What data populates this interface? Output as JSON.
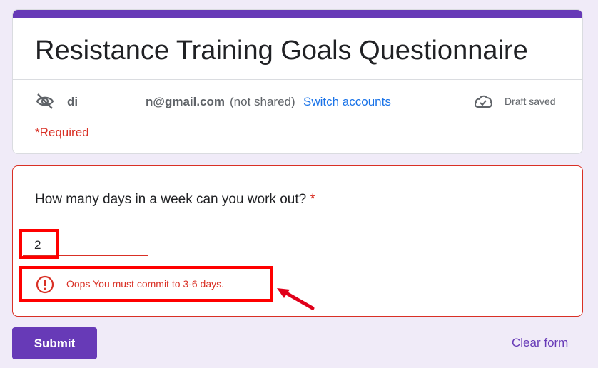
{
  "form": {
    "title": "Resistance Training Goals Questionnaire",
    "account_name": "di",
    "account_email": "n@gmail.com",
    "not_shared": "(not shared)",
    "switch_accounts": "Switch accounts",
    "draft_status": "Draft saved",
    "required_note": "*Required"
  },
  "question": {
    "title": "How many days in a week can you work out?",
    "required_marker": "*",
    "answer_value": "2",
    "error_message": "Oops You must commit to 3-6 days."
  },
  "footer": {
    "submit_label": "Submit",
    "clear_label": "Clear form"
  },
  "colors": {
    "brand": "#673ab7",
    "error": "#d93025",
    "link": "#1a73e8",
    "annotation": "#ff0000"
  },
  "icons": {
    "account_visibility": "eye-off-icon",
    "draft": "cloud-check-icon",
    "error": "error-circle-icon"
  }
}
